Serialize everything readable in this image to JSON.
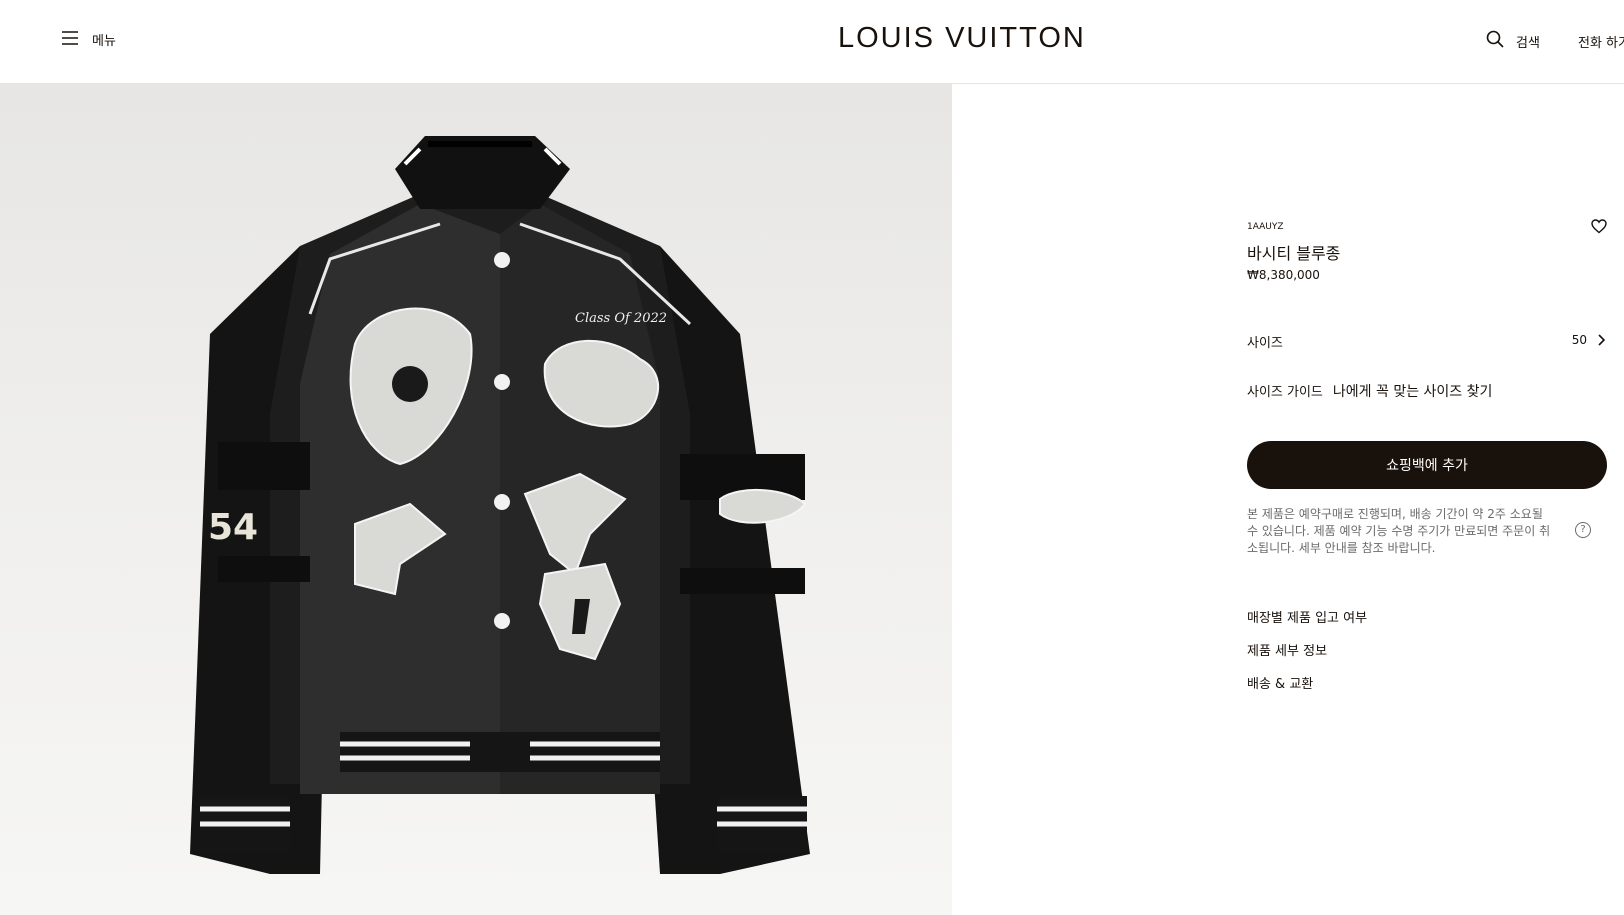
{
  "header": {
    "menu_label": "메뉴",
    "logo": "LOUIS VUITTON",
    "search_label": "검색",
    "call_label": "전화 하기"
  },
  "product": {
    "sku": "1AAUYZ",
    "name": "바시티 블루종",
    "price": "₩8,380,000",
    "size_label": "사이즈",
    "size_value": "50",
    "size_guide": "사이즈 가이드",
    "fit_finder": "나에게 꼭 맞는 사이즈 찾기",
    "add_to_bag": "쇼핑백에 추가",
    "notice": "본 제품은 예약구매로 진행되며, 배송 기간이 약 2주 소요될 수 있습니다. 제품 예약 기능 수명 주기가 만료되면 주문이 취소됩니다. 세부 안내를 참조 바랍니다.",
    "links": [
      "매장별 제품 입고 여부",
      "제품 세부 정보",
      "배송 & 교환"
    ]
  },
  "image": {
    "patch_text": "Class Of 2022",
    "sleeve_number": "54"
  },
  "colors": {
    "brand": "#19110b",
    "notice_text": "#6b6b6b"
  },
  "icons": [
    "menu-icon",
    "search-icon",
    "heart-icon",
    "chevron-right-icon",
    "help-icon"
  ]
}
